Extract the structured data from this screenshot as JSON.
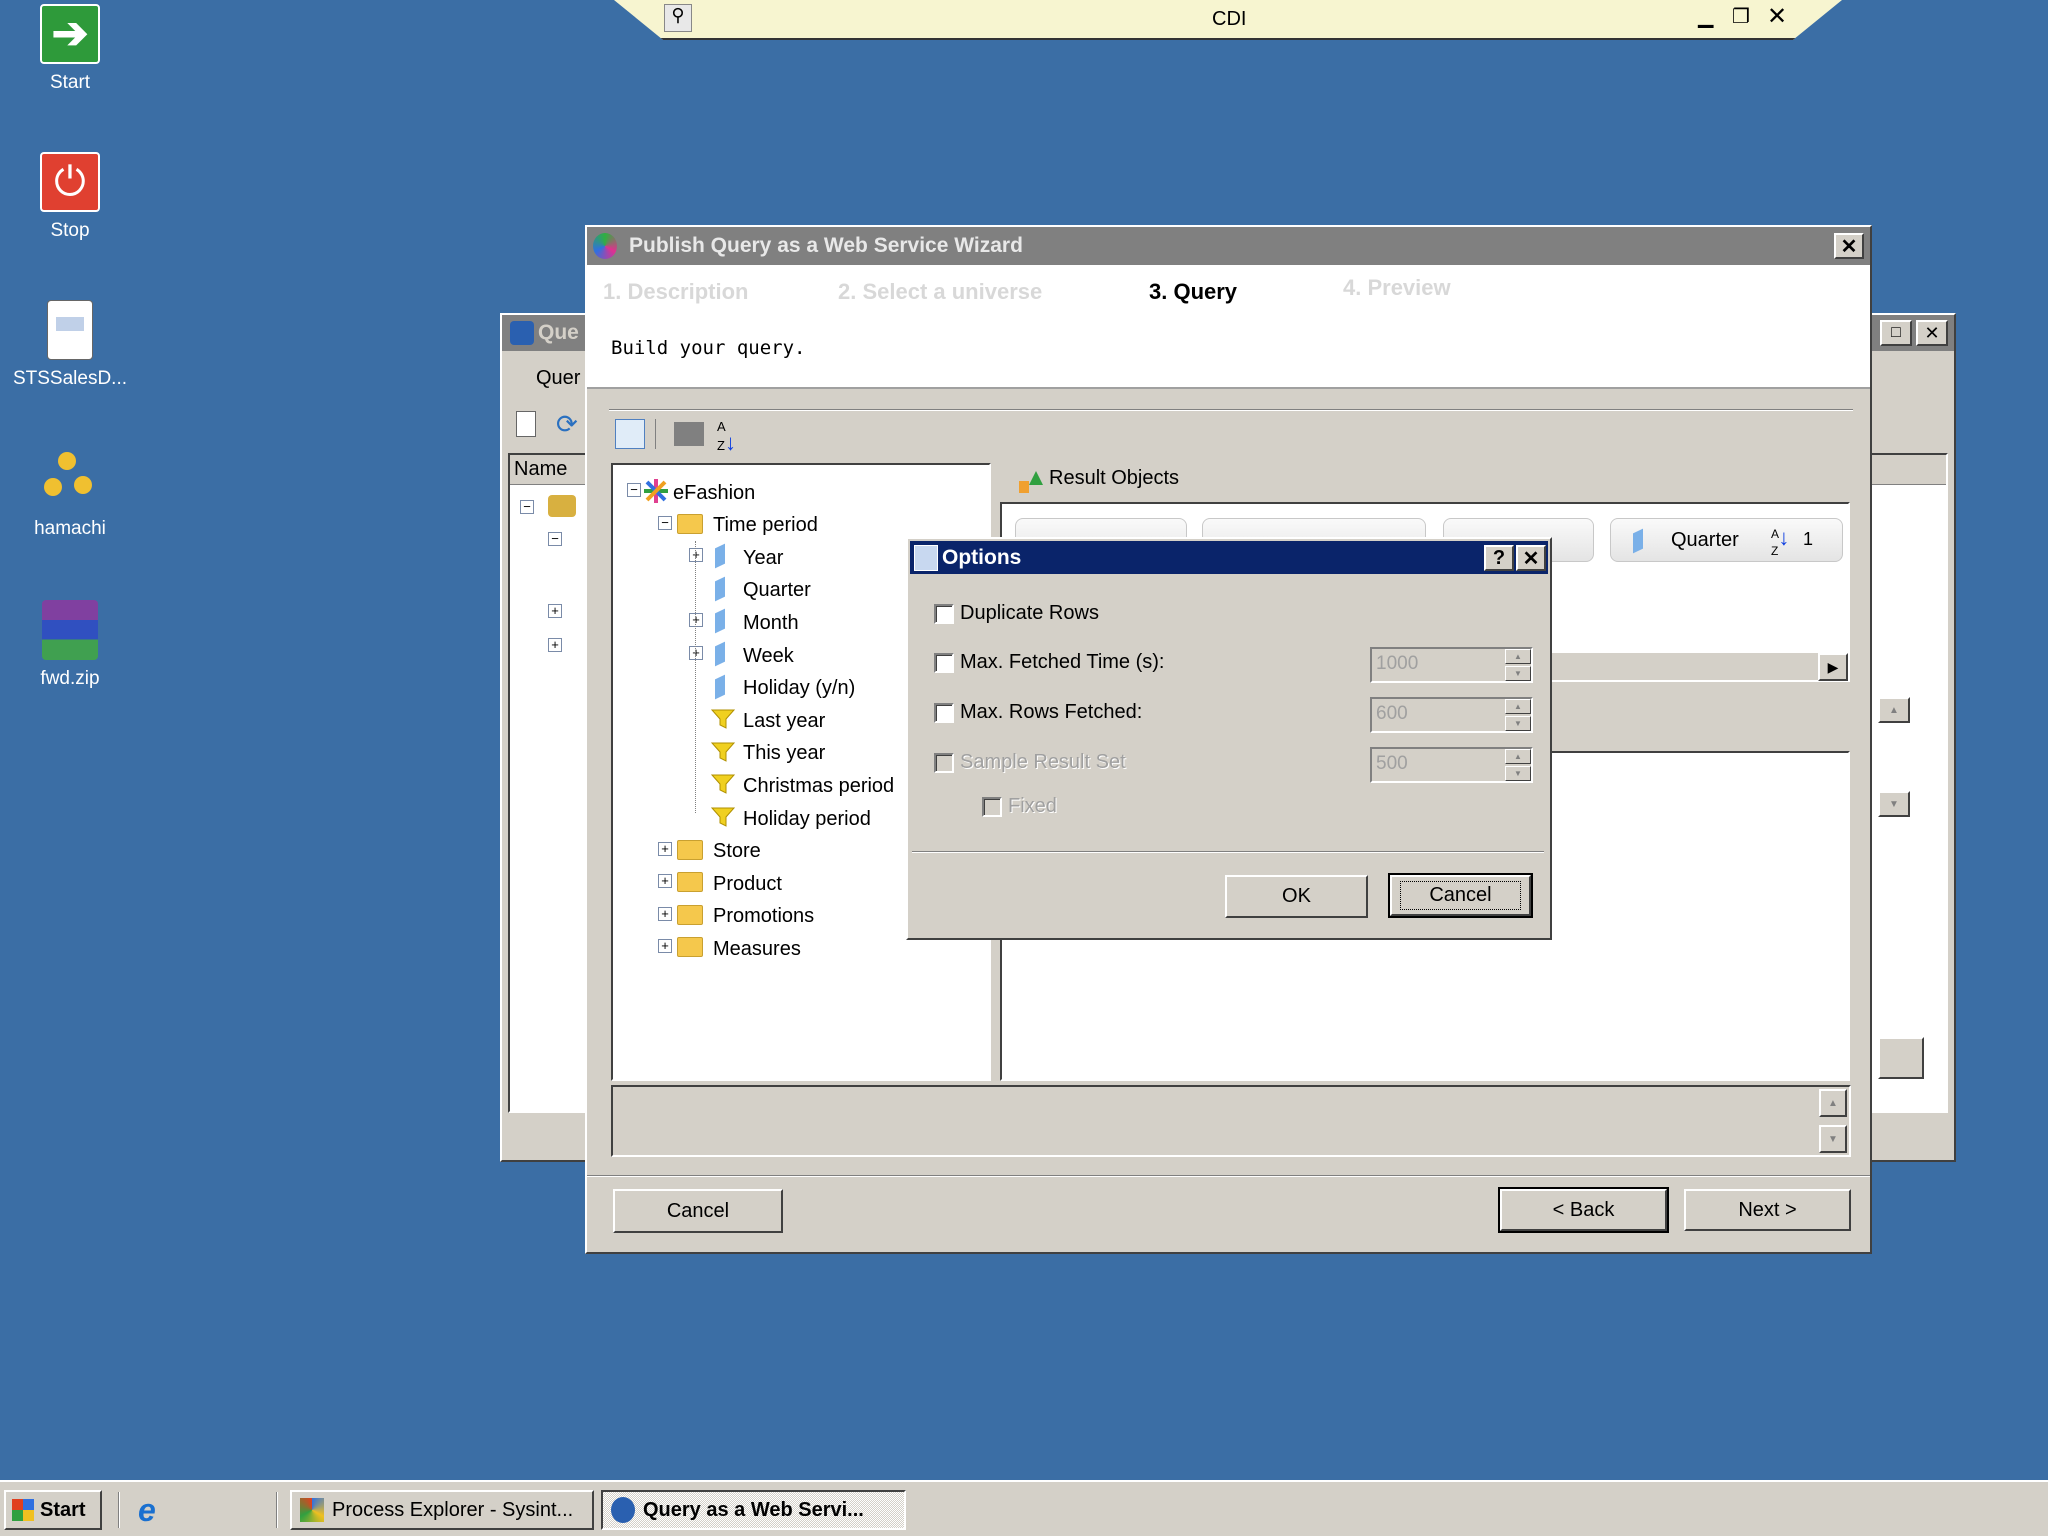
{
  "desktop": {
    "icons": [
      {
        "label": "Start",
        "icon": "start-arrow-icon"
      },
      {
        "label": "Stop",
        "icon": "stop-power-icon"
      },
      {
        "label": "STSSalesD...",
        "icon": "document-icon"
      },
      {
        "label": "hamachi",
        "icon": "hamachi-icon"
      },
      {
        "label": "fwd.zip",
        "icon": "winrar-archive-icon"
      }
    ]
  },
  "remote_bar": {
    "title": "CDI"
  },
  "background_window": {
    "title": "Que",
    "menu": "Quer",
    "column_header": "Name"
  },
  "wizard": {
    "title": "Publish Query as a Web Service Wizard",
    "steps": [
      "1. Description",
      "2. Select a universe",
      "3. Query",
      "4. Preview"
    ],
    "active_step": 2,
    "instruction": "Build your query.",
    "result_objects_label": "Result Objects",
    "result_chip": {
      "label": "Quarter",
      "sort_index": "1"
    },
    "buttons": {
      "cancel": "Cancel",
      "back": "< Back",
      "next": "Next >"
    },
    "tree": [
      {
        "label": "eFashion",
        "level": 0,
        "expander": "-",
        "icon": "universe"
      },
      {
        "label": "Time period",
        "level": 1,
        "expander": "-",
        "icon": "folder"
      },
      {
        "label": "Year",
        "level": 2,
        "expander": "+",
        "icon": "dimension"
      },
      {
        "label": "Quarter",
        "level": 2,
        "expander": "",
        "icon": "dimension"
      },
      {
        "label": "Month",
        "level": 2,
        "expander": "+",
        "icon": "dimension"
      },
      {
        "label": "Week",
        "level": 2,
        "expander": "+",
        "icon": "dimension"
      },
      {
        "label": "Holiday (y/n)",
        "level": 2,
        "expander": "",
        "icon": "dimension"
      },
      {
        "label": "Last year",
        "level": 2,
        "expander": "",
        "icon": "filter"
      },
      {
        "label": "This year",
        "level": 2,
        "expander": "",
        "icon": "filter"
      },
      {
        "label": "Christmas period",
        "level": 2,
        "expander": "",
        "icon": "filter"
      },
      {
        "label": "Holiday period",
        "level": 2,
        "expander": "",
        "icon": "filter"
      },
      {
        "label": "Store",
        "level": 1,
        "expander": "+",
        "icon": "folder"
      },
      {
        "label": "Product",
        "level": 1,
        "expander": "+",
        "icon": "folder"
      },
      {
        "label": "Promotions",
        "level": 1,
        "expander": "+",
        "icon": "folder"
      },
      {
        "label": "Measures",
        "level": 1,
        "expander": "+",
        "icon": "folder"
      }
    ]
  },
  "options_dialog": {
    "title": "Options",
    "help": "?",
    "duplicate_rows": {
      "label": "Duplicate Rows",
      "checked": false
    },
    "max_fetched_time": {
      "label": "Max. Fetched Time (s):",
      "checked": false,
      "value": "1000"
    },
    "max_rows_fetched": {
      "label": "Max. Rows Fetched:",
      "checked": false,
      "value": "600"
    },
    "sample_result_set": {
      "label": "Sample Result Set",
      "checked": false,
      "enabled": false,
      "value": "500"
    },
    "fixed": {
      "label": "Fixed",
      "checked": false,
      "enabled": false
    },
    "ok": "OK",
    "cancel": "Cancel"
  },
  "taskbar": {
    "start": "Start",
    "tasks": [
      {
        "label": "Process Explorer - Sysint...",
        "active": false
      },
      {
        "label": "Query as a Web Servi...",
        "active": true
      }
    ]
  },
  "colors": {
    "desktop": "#3b6ea5",
    "dialog_title": "#0a246a",
    "inactive_title": "#808080",
    "face": "#d4d0c8"
  }
}
